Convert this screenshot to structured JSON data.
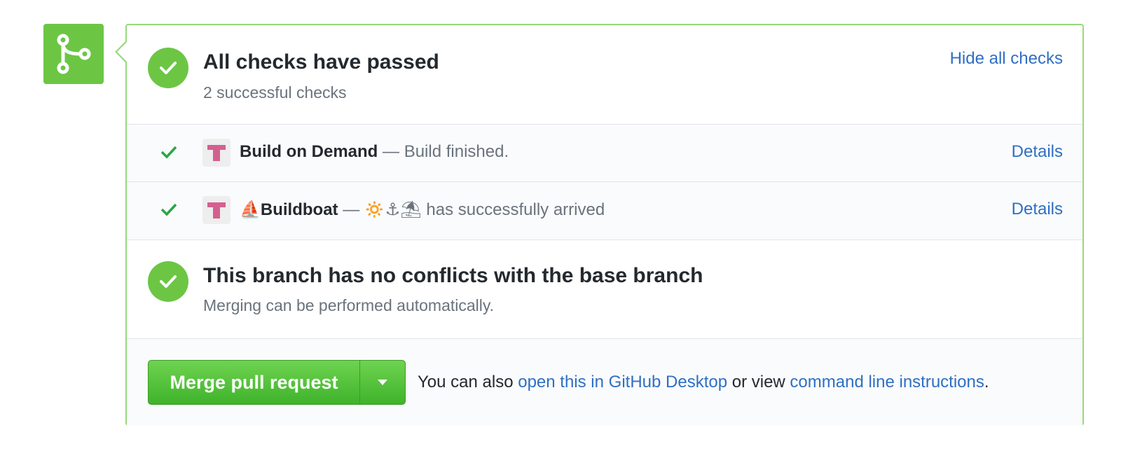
{
  "colors": {
    "success": "#6cc644",
    "border": "#97d87b",
    "link": "#2f6fc4",
    "muted": "#6a737d",
    "app_icon": "#d4608f"
  },
  "checks_summary": {
    "title": "All checks have passed",
    "subtitle": "2 successful checks",
    "toggle_label": "Hide all checks"
  },
  "checks": [
    {
      "app_icon": "tshirt-icon",
      "name": "Build on Demand",
      "separator": " — ",
      "description": "Build finished.",
      "details_label": "Details"
    },
    {
      "app_icon": "tshirt-icon",
      "name": "⛵Buildboat",
      "separator": " — ",
      "description": "🔅⚓⛱ has successfully arrived",
      "details_label": "Details"
    }
  ],
  "branch_status": {
    "title": "This branch has no conflicts with the base branch",
    "subtitle": "Merging can be performed automatically."
  },
  "merge": {
    "button_label": "Merge pull request",
    "note_prefix": "You can also ",
    "desktop_link": "open this in GitHub Desktop",
    "note_middle": " or view ",
    "cli_link": "command line instructions",
    "note_suffix": "."
  }
}
